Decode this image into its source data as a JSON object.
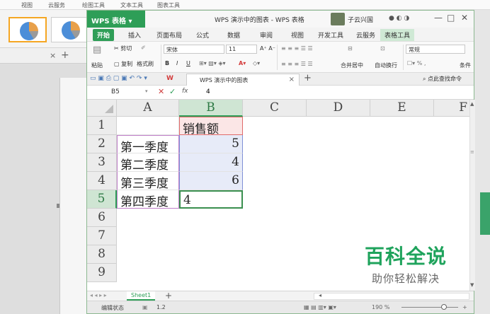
{
  "background": {
    "menu": [
      "视图",
      "云服务",
      "绘图工具",
      "文本工具",
      "图表工具"
    ]
  },
  "window": {
    "app_label": "WPS 表格",
    "title": "WPS 演示中的图表 - WPS 表格",
    "user": "子云兴国",
    "controls": [
      "—",
      "□",
      "✕"
    ]
  },
  "menubar": {
    "items": [
      "开始",
      "插入",
      "页面布局",
      "公式",
      "数据",
      "审阅",
      "视图",
      "开发工具",
      "云服务",
      "表格工具"
    ]
  },
  "ribbon": {
    "paste": "粘贴",
    "cut": "剪切",
    "copy": "复制",
    "format_painter": "格式刷",
    "font_name": "宋体",
    "font_size": "11",
    "bold": "B",
    "italic": "I",
    "underline": "U",
    "merge_center": "合并居中",
    "wrap": "自动换行",
    "number_format": "常规",
    "cond_fmt": "条件"
  },
  "doctab": {
    "title": "WPS 演示中的图表",
    "find_cmd": "点此查找命令"
  },
  "formula": {
    "cell_ref": "B5",
    "fx": "fx",
    "value": "4"
  },
  "sheet": {
    "columns": [
      "A",
      "B",
      "C",
      "D",
      "E",
      "F"
    ],
    "rows": [
      "1",
      "2",
      "3",
      "4",
      "5",
      "6",
      "7",
      "8",
      "9"
    ],
    "header_b1": "销售额",
    "labels": [
      "第一季度",
      "第二季度",
      "第三季度",
      "第四季度"
    ],
    "values": [
      "5",
      "4",
      "6",
      "4"
    ]
  },
  "watermark": {
    "main": "百科全说",
    "sub": "助你轻松解决"
  },
  "sheetbar": {
    "tab": "Sheet1",
    "add": "+"
  },
  "statusbar": {
    "mode": "编辑状态",
    "value": "1.2",
    "zoom": "190 %"
  }
}
